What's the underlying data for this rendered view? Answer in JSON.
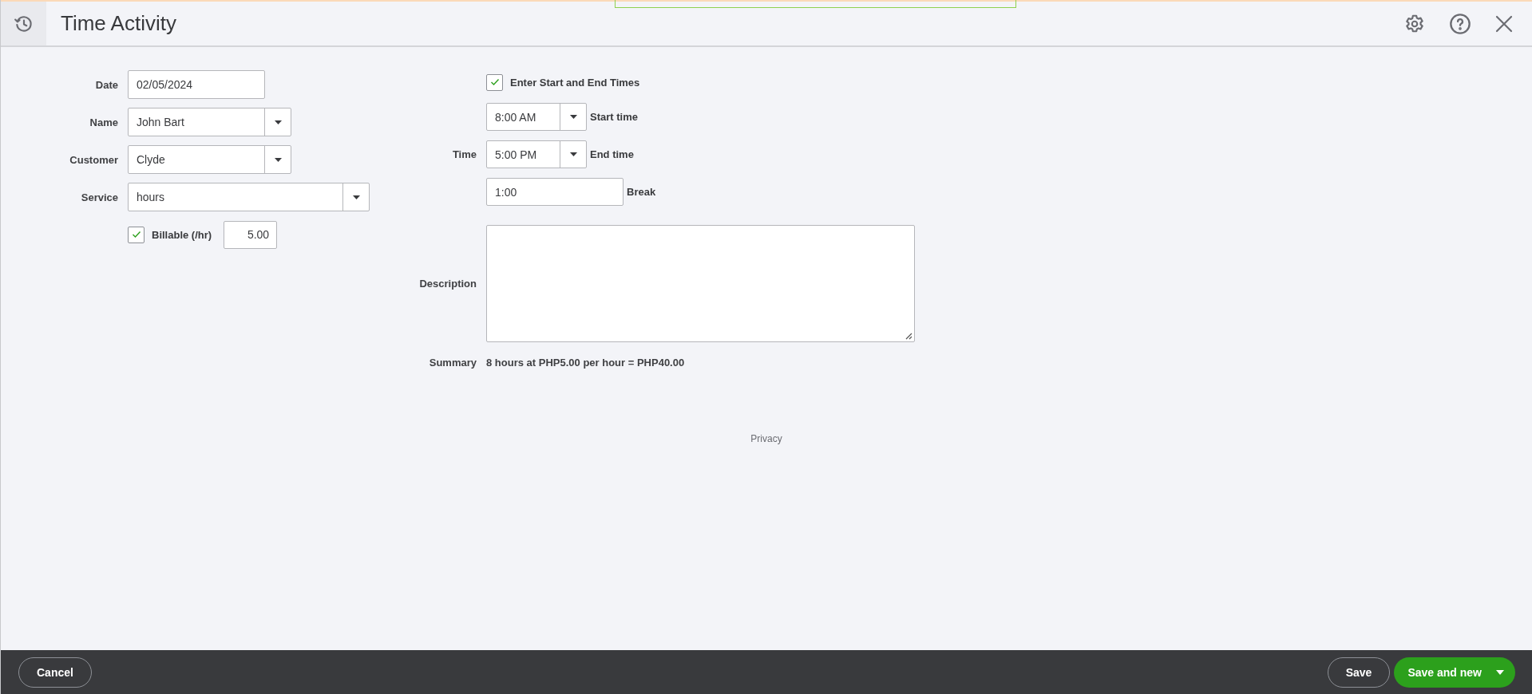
{
  "header": {
    "title": "Time Activity"
  },
  "details": {
    "fields": [
      {
        "label": "Date",
        "kind": "text",
        "value": "02/05/2024"
      },
      {
        "label": "Name",
        "kind": "dropdown",
        "value": "John Bart"
      },
      {
        "label": "Customer",
        "kind": "dropdown",
        "value": "Clyde"
      },
      {
        "label": "Service",
        "kind": "dropdown-wide",
        "value": "hours"
      }
    ],
    "billable": {
      "label": "Billable (/hr)",
      "checked": true,
      "rate": "5.00"
    }
  },
  "time": {
    "enter_times": {
      "label": "Enter Start and End Times",
      "checked": true
    },
    "label": "Time",
    "rows": [
      {
        "kind": "dropdown",
        "value": "8:00 AM",
        "caption": "Start time"
      },
      {
        "kind": "dropdown",
        "value": "5:00 PM",
        "caption": "End time"
      },
      {
        "kind": "text",
        "value": "1:00",
        "caption": "Break"
      }
    ]
  },
  "description": {
    "label": "Description"
  },
  "summary": {
    "label": "Summary",
    "text": "8 hours at PHP5.00 per hour = PHP40.00"
  },
  "privacy_link": "Privacy",
  "footer": {
    "cancel": "Cancel",
    "save": "Save",
    "save_and_new": "Save and new"
  }
}
